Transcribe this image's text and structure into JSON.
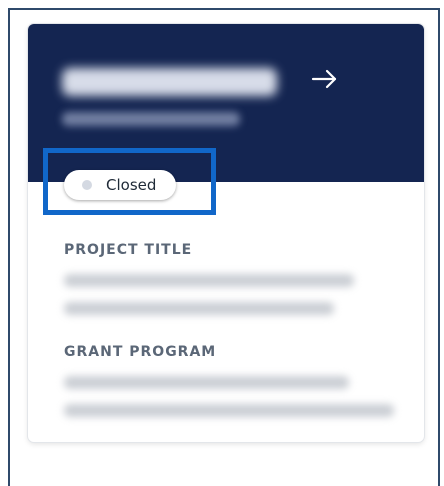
{
  "card": {
    "status": {
      "label": "Closed"
    },
    "fields": [
      {
        "label": "PROJECT TITLE"
      },
      {
        "label": "GRANT PROGRAM"
      }
    ]
  },
  "icons": {
    "header_action": "arrow-right-icon",
    "status_indicator": "status-dot-icon"
  },
  "colors": {
    "header_background": "#142551",
    "highlight_border": "#1167c9",
    "frame_border": "#2f4a6b",
    "label_text": "#5b6777",
    "status_dot": "#d4d9e2"
  }
}
